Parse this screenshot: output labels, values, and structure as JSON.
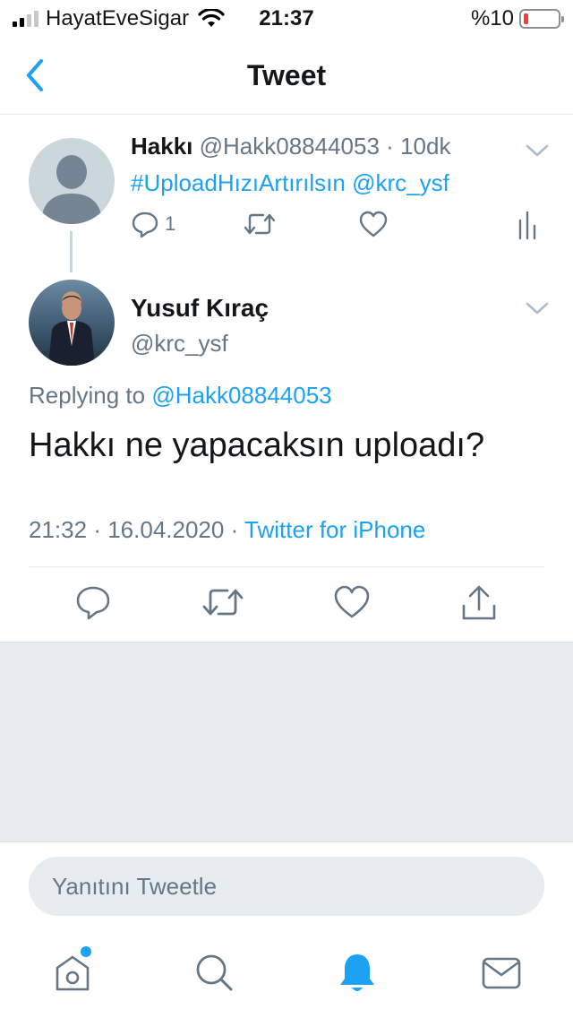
{
  "status_bar": {
    "carrier": "HayatEveSigar",
    "time": "21:37",
    "battery_text": "%10"
  },
  "nav": {
    "title": "Tweet"
  },
  "parent_tweet": {
    "name": "Hakkı",
    "handle": "@Hakk08844053",
    "separator": "·",
    "age": "10dk",
    "text": "#UploadHızıArtırılsın @krc_ysf",
    "reply_count": "1"
  },
  "main_tweet": {
    "name": "Yusuf Kıraç",
    "handle": "@krc_ysf",
    "replying_prefix": "Replying to",
    "replying_handle": "@Hakk08844053",
    "text": "Hakkı ne yapacaksın uploadı?",
    "time": "21:32",
    "sep": "·",
    "date": "16.04.2020",
    "source": "Twitter for iPhone"
  },
  "reply": {
    "placeholder": "Yanıtını Tweetle"
  },
  "colors": {
    "accent": "#1da1f2",
    "muted": "#657786",
    "background_grey": "#e6ecf0"
  },
  "icons": [
    "back-chevron-icon",
    "chevron-down-icon",
    "reply-icon",
    "retweet-icon",
    "like-icon",
    "analytics-icon",
    "share-icon",
    "home-icon",
    "search-icon",
    "notifications-icon",
    "messages-icon"
  ]
}
